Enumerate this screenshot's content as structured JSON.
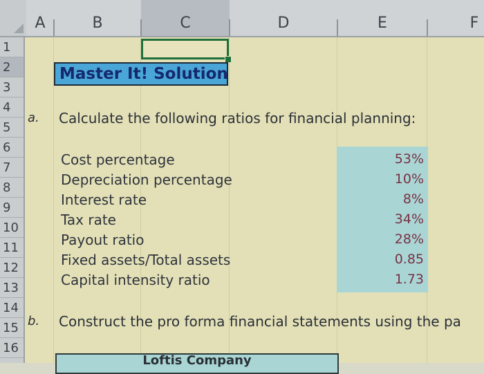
{
  "columns": [
    "A",
    "B",
    "C",
    "D",
    "E",
    "F"
  ],
  "rows": [
    "1",
    "2",
    "3",
    "4",
    "5",
    "6",
    "7",
    "8",
    "9",
    "10",
    "11",
    "12",
    "13",
    "14",
    "15",
    "16"
  ],
  "selected_column": "C",
  "title": "Master It! Solution",
  "part_a": {
    "marker": "a.",
    "text": "Calculate the following ratios for financial planning:"
  },
  "ratios": [
    {
      "label": "Cost percentage",
      "value": "53%"
    },
    {
      "label": "Depreciation percentage",
      "value": "10%"
    },
    {
      "label": "Interest rate",
      "value": "8%"
    },
    {
      "label": "Tax rate",
      "value": "34%"
    },
    {
      "label": "Payout ratio",
      "value": "28%"
    },
    {
      "label": "Fixed assets/Total assets",
      "value": "0.85"
    },
    {
      "label": "Capital intensity ratio",
      "value": "1.73"
    }
  ],
  "part_b": {
    "marker": "b.",
    "text": "Construct the pro forma financial statements using the pa"
  },
  "company": "Loftis Company",
  "colors": {
    "title_fill": "#4aa6d6",
    "value_fill": "#a9d6d4",
    "cell_fill": "#e3e0b7",
    "selection": "#1f6f3a"
  }
}
